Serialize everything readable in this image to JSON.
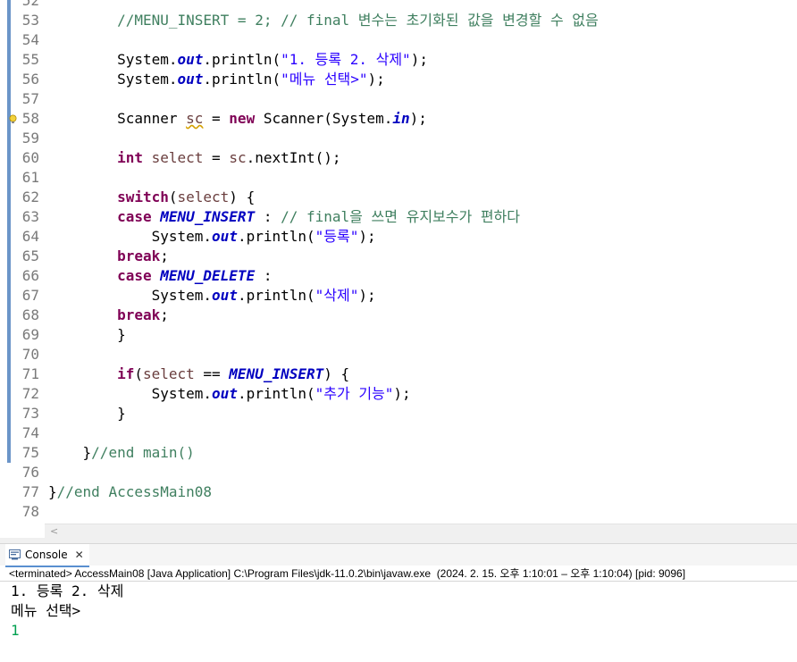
{
  "editor": {
    "lines": [
      {
        "num": "52",
        "segs": []
      },
      {
        "num": "53",
        "segs": [
          {
            "t": "        "
          },
          {
            "t": "//MENU_INSERT = 2; // final 변수는 초기화된 값을 변경할 수 없음",
            "c": "cm"
          }
        ]
      },
      {
        "num": "54",
        "segs": []
      },
      {
        "num": "55",
        "segs": [
          {
            "t": "        System."
          },
          {
            "t": "out",
            "c": "fld"
          },
          {
            "t": ".println("
          },
          {
            "t": "\"1. 등록 2. 삭제\"",
            "c": "str"
          },
          {
            "t": ");"
          }
        ]
      },
      {
        "num": "56",
        "segs": [
          {
            "t": "        System."
          },
          {
            "t": "out",
            "c": "fld"
          },
          {
            "t": ".println("
          },
          {
            "t": "\"메뉴 선택>\"",
            "c": "str"
          },
          {
            "t": ");"
          }
        ]
      },
      {
        "num": "57",
        "segs": []
      },
      {
        "num": "58",
        "segs": [
          {
            "t": "        Scanner "
          },
          {
            "t": "sc",
            "c": "var warn-underline"
          },
          {
            "t": " = "
          },
          {
            "t": "new",
            "c": "kw"
          },
          {
            "t": " Scanner(System."
          },
          {
            "t": "in",
            "c": "fld"
          },
          {
            "t": ");"
          }
        ]
      },
      {
        "num": "59",
        "segs": []
      },
      {
        "num": "60",
        "segs": [
          {
            "t": "        "
          },
          {
            "t": "int",
            "c": "kw"
          },
          {
            "t": " "
          },
          {
            "t": "select",
            "c": "var"
          },
          {
            "t": " = "
          },
          {
            "t": "sc",
            "c": "var"
          },
          {
            "t": ".nextInt();"
          }
        ]
      },
      {
        "num": "61",
        "segs": []
      },
      {
        "num": "62",
        "segs": [
          {
            "t": "        "
          },
          {
            "t": "switch",
            "c": "kw"
          },
          {
            "t": "("
          },
          {
            "t": "select",
            "c": "var"
          },
          {
            "t": ") {"
          }
        ]
      },
      {
        "num": "63",
        "segs": [
          {
            "t": "        "
          },
          {
            "t": "case",
            "c": "kw"
          },
          {
            "t": " "
          },
          {
            "t": "MENU_INSERT",
            "c": "fld"
          },
          {
            "t": " : "
          },
          {
            "t": "// final을 쓰면 유지보수가 편하다",
            "c": "cm"
          }
        ]
      },
      {
        "num": "64",
        "segs": [
          {
            "t": "            System."
          },
          {
            "t": "out",
            "c": "fld"
          },
          {
            "t": ".println("
          },
          {
            "t": "\"등록\"",
            "c": "str"
          },
          {
            "t": ");"
          }
        ]
      },
      {
        "num": "65",
        "segs": [
          {
            "t": "        "
          },
          {
            "t": "break",
            "c": "kw"
          },
          {
            "t": ";"
          }
        ]
      },
      {
        "num": "66",
        "segs": [
          {
            "t": "        "
          },
          {
            "t": "case",
            "c": "kw"
          },
          {
            "t": " "
          },
          {
            "t": "MENU_DELETE",
            "c": "fld"
          },
          {
            "t": " :"
          }
        ]
      },
      {
        "num": "67",
        "segs": [
          {
            "t": "            System."
          },
          {
            "t": "out",
            "c": "fld"
          },
          {
            "t": ".println("
          },
          {
            "t": "\"삭제\"",
            "c": "str"
          },
          {
            "t": ");"
          }
        ]
      },
      {
        "num": "68",
        "segs": [
          {
            "t": "        "
          },
          {
            "t": "break",
            "c": "kw"
          },
          {
            "t": ";"
          }
        ]
      },
      {
        "num": "69",
        "segs": [
          {
            "t": "        }"
          }
        ]
      },
      {
        "num": "70",
        "segs": []
      },
      {
        "num": "71",
        "segs": [
          {
            "t": "        "
          },
          {
            "t": "if",
            "c": "kw"
          },
          {
            "t": "("
          },
          {
            "t": "select",
            "c": "var"
          },
          {
            "t": " == "
          },
          {
            "t": "MENU_INSERT",
            "c": "fld"
          },
          {
            "t": ") {"
          }
        ]
      },
      {
        "num": "72",
        "segs": [
          {
            "t": "            System."
          },
          {
            "t": "out",
            "c": "fld"
          },
          {
            "t": ".println("
          },
          {
            "t": "\"추가 기능\"",
            "c": "str"
          },
          {
            "t": ");"
          }
        ]
      },
      {
        "num": "73",
        "segs": [
          {
            "t": "        }"
          }
        ]
      },
      {
        "num": "74",
        "segs": []
      },
      {
        "num": "75",
        "segs": [
          {
            "t": "    }"
          },
          {
            "t": "//end main()",
            "c": "cm"
          }
        ]
      },
      {
        "num": "76",
        "segs": []
      },
      {
        "num": "77",
        "segs": [
          {
            "t": "}"
          },
          {
            "t": "//end AccessMain08",
            "c": "cm"
          }
        ]
      },
      {
        "num": "78",
        "segs": []
      }
    ]
  },
  "console": {
    "tab_label": "Console",
    "status": "<terminated> AccessMain08 [Java Application] C:\\Program Files\\jdk-11.0.2\\bin\\javaw.exe  (2024. 2. 15. 오후 1:10:01 – 오후 1:10:04) [pid: 9096]",
    "output": [
      {
        "text": "1. 등록 2. 삭제",
        "color": "#000000"
      },
      {
        "text": "메뉴 선택>",
        "color": "#000000"
      },
      {
        "text": "1",
        "color": "#00a050"
      }
    ]
  },
  "colors": {
    "keyword": "#7f0055",
    "comment": "#3f7f5f",
    "string": "#2a00ff",
    "field": "#0000c0",
    "line_number": "#7a7a7a",
    "change_bar": "#6b95c8",
    "user_input": "#00a050"
  },
  "icons": {
    "warning_marker": "warning-lightbulb-icon",
    "console_tab": "console-icon",
    "close": "close-icon",
    "scroll_left": "scroll-left-arrow-icon"
  }
}
